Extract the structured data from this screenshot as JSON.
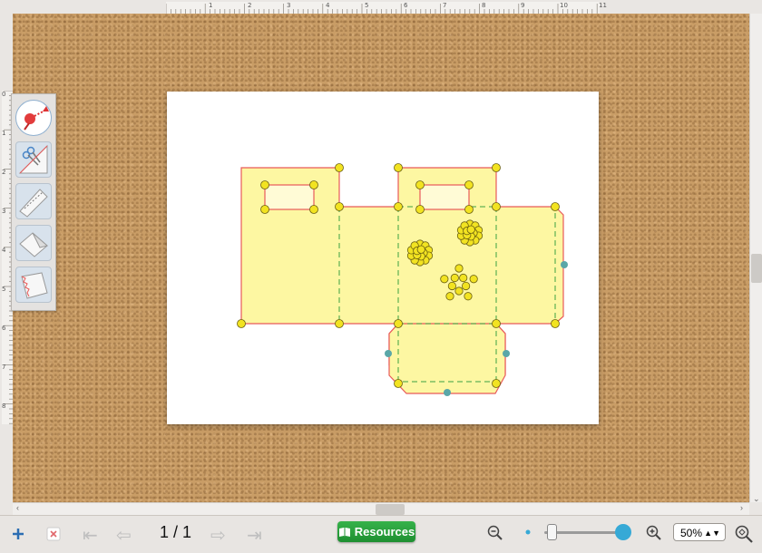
{
  "ruler": {
    "top_labels": [
      "1",
      "2",
      "3",
      "4",
      "5",
      "6",
      "7",
      "8",
      "9",
      "10",
      "11"
    ],
    "left_labels": [
      "0",
      "1",
      "2",
      "3",
      "4",
      "5",
      "6",
      "7",
      "8"
    ]
  },
  "toolbox": {
    "tools": [
      {
        "name": "select-pin-tool",
        "icon": "pin-arrow-icon",
        "active": true
      },
      {
        "name": "cut-tool",
        "icon": "scissors-icon",
        "active": false
      },
      {
        "name": "perforate-tool",
        "icon": "perforation-icon",
        "active": false
      },
      {
        "name": "fold-tool",
        "icon": "fold-icon",
        "active": false
      },
      {
        "name": "edge-tool",
        "icon": "edge-cut-icon",
        "active": false
      }
    ]
  },
  "colors": {
    "cork": "#c99d66",
    "shape_fill": "#fdf7a2",
    "cut_line": "#e85a5a",
    "fold_line": "#3aa043",
    "handle": "#f2e321",
    "handle_teal": "#5aa7a8",
    "resources_green": "#2aa53d"
  },
  "bottom": {
    "add_icon": "plus-icon",
    "delete_icon": "close-icon",
    "first_icon": "first-page-icon",
    "prev_icon": "prev-page-icon",
    "page_indicator": "1 / 1",
    "next_icon": "next-page-icon",
    "last_icon": "last-page-icon",
    "resources_label": "Resources",
    "zoom_out_icon": "zoom-out-icon",
    "zoom_in_icon": "zoom-in-icon",
    "zoom_value": "50%",
    "zoom_fit_icon": "zoom-fit-icon",
    "slider_level": 0.05
  }
}
